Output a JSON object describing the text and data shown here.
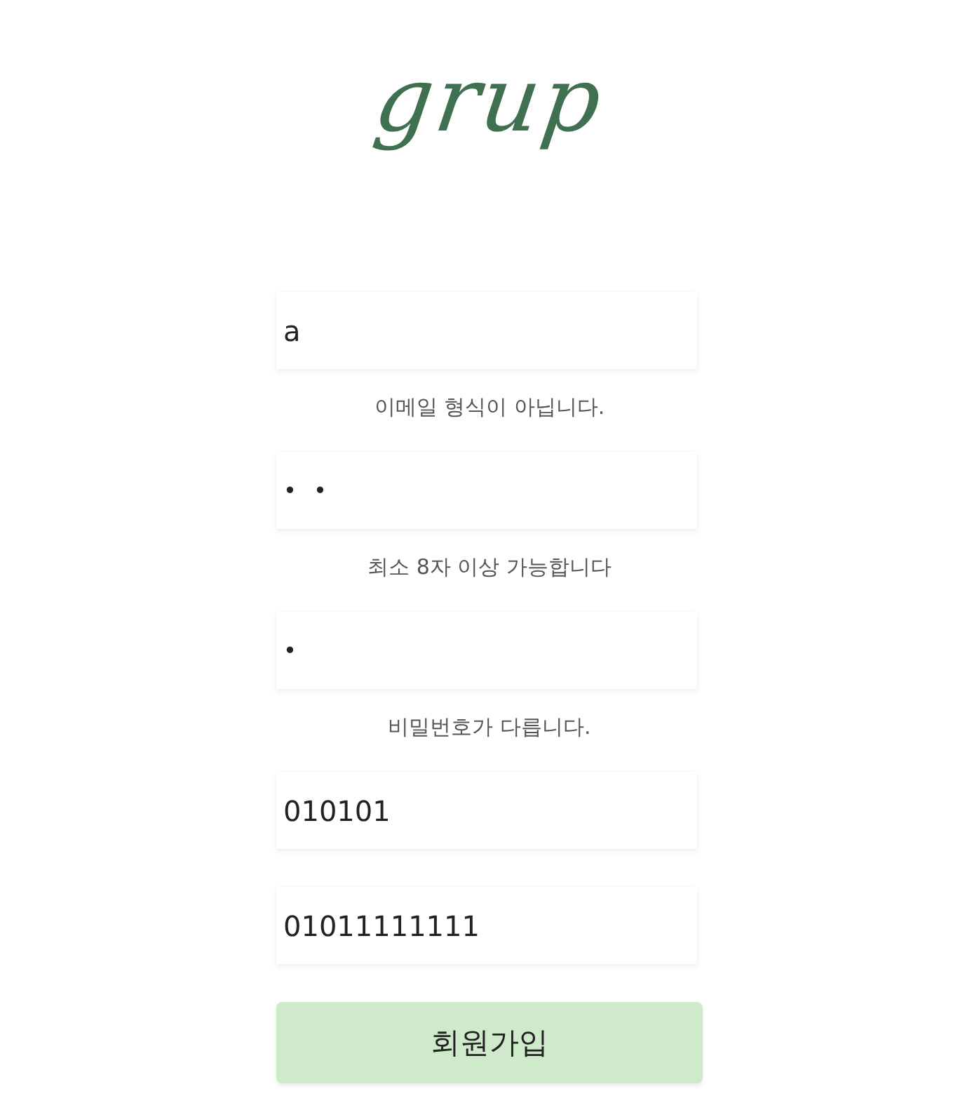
{
  "logo": {
    "text": "grup"
  },
  "fields": [
    {
      "kind": "text",
      "value": "a",
      "error": "이메일 형식이 아닙니다."
    },
    {
      "kind": "password",
      "value": "••",
      "error": "최소 8자 이상 가능합니다"
    },
    {
      "kind": "password",
      "value": "•",
      "error": "비밀번호가 다릅니다."
    },
    {
      "kind": "text",
      "value": "010101"
    },
    {
      "kind": "text",
      "value": "01011111111"
    }
  ],
  "submit": {
    "label": "회원가입"
  }
}
